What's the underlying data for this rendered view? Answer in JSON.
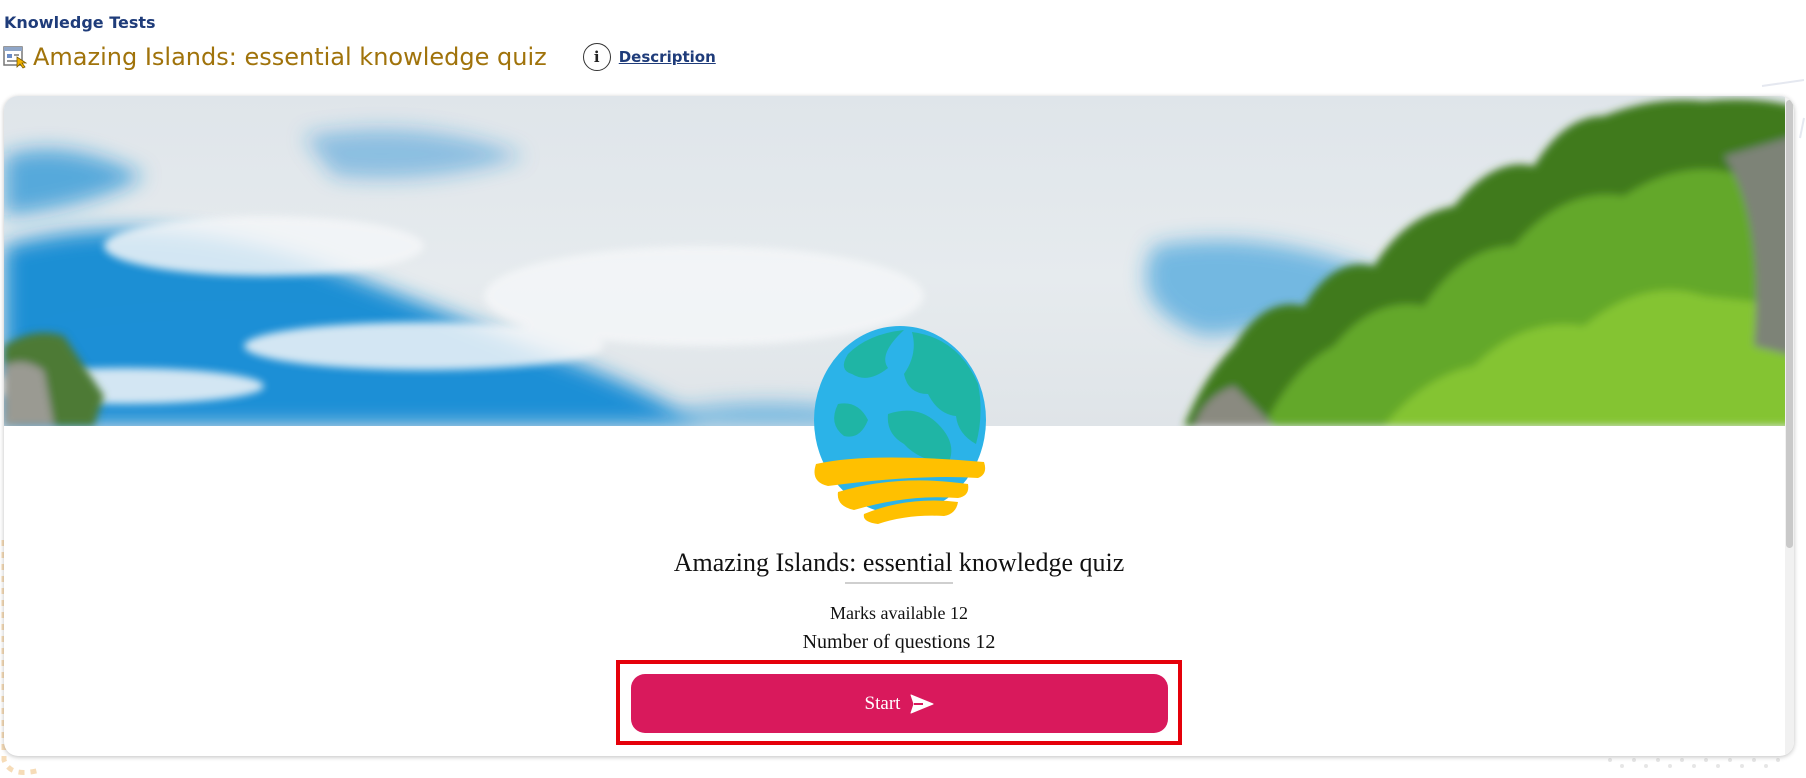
{
  "header": {
    "breadcrumb": "Knowledge Tests",
    "title": "Amazing Islands: essential knowledge quiz",
    "info_icon_glyph": "i",
    "description_link": "Description"
  },
  "quiz": {
    "title": "Amazing Islands: essential knowledge quiz",
    "marks_text": "Marks available 12",
    "questions_text": "Number of questions 12",
    "start_label": "Start"
  },
  "colors": {
    "breadcrumb": "#1f3c7a",
    "title": "#a0730b",
    "start_button": "#d9195c",
    "highlight_border": "#e5000a"
  },
  "icons": [
    "quiz-page-icon",
    "info-icon",
    "globe-logo-icon",
    "send-arrow-icon"
  ]
}
